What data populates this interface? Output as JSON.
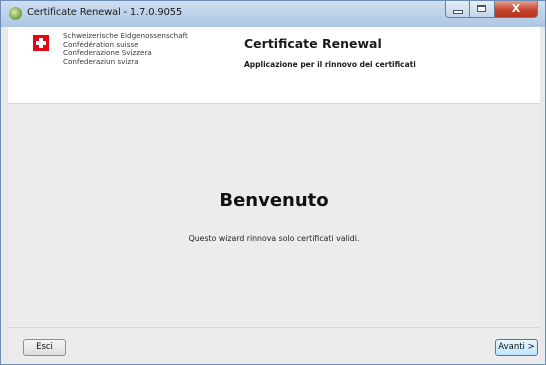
{
  "window": {
    "title": "Certificate Renewal - 1.7.0.9055",
    "controls": {
      "minimize_icon": "minimize-icon",
      "maximize_icon": "maximize-icon",
      "close_label": "X"
    }
  },
  "header": {
    "logo_icon": "swiss-cross-icon",
    "confederation_lines": [
      "Schweizerische Eidgenossenschaft",
      "Confédération suisse",
      "Confederazione Svizzera",
      "Confederaziun svizra"
    ],
    "title": "Certificate Renewal",
    "subtitle": "Applicazione per il rinnovo dei certificati"
  },
  "main": {
    "heading": "Benvenuto",
    "description": "Questo wizard rinnova solo certificati validi."
  },
  "footer": {
    "exit_label": "Esci",
    "next_label": "Avanti >"
  },
  "colors": {
    "accent_red": "#e30613",
    "titlebar": "#bfd3ea",
    "close_button": "#c7462e"
  }
}
